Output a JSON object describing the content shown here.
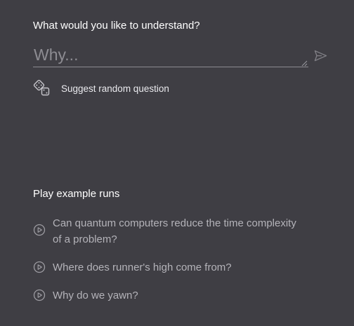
{
  "prompt": {
    "label": "What would you like to understand?",
    "input_placeholder": "Why...",
    "input_value": "",
    "send_icon": "send-icon"
  },
  "suggest": {
    "icon": "dice-icon",
    "label": "Suggest random question"
  },
  "examples": {
    "heading": "Play example runs",
    "icon": "play-circle-icon",
    "items": [
      {
        "line1": "Can quantum computers reduce the time complexity",
        "line2": "of a problem?"
      },
      {
        "line1": "Where does runner's high come from?"
      },
      {
        "line1": "Why do we yawn?"
      }
    ]
  },
  "colors": {
    "background": "#3f3e44",
    "text_primary": "#ffffff",
    "text_muted": "#b4b3b9",
    "icon": "#9c9ba1"
  }
}
